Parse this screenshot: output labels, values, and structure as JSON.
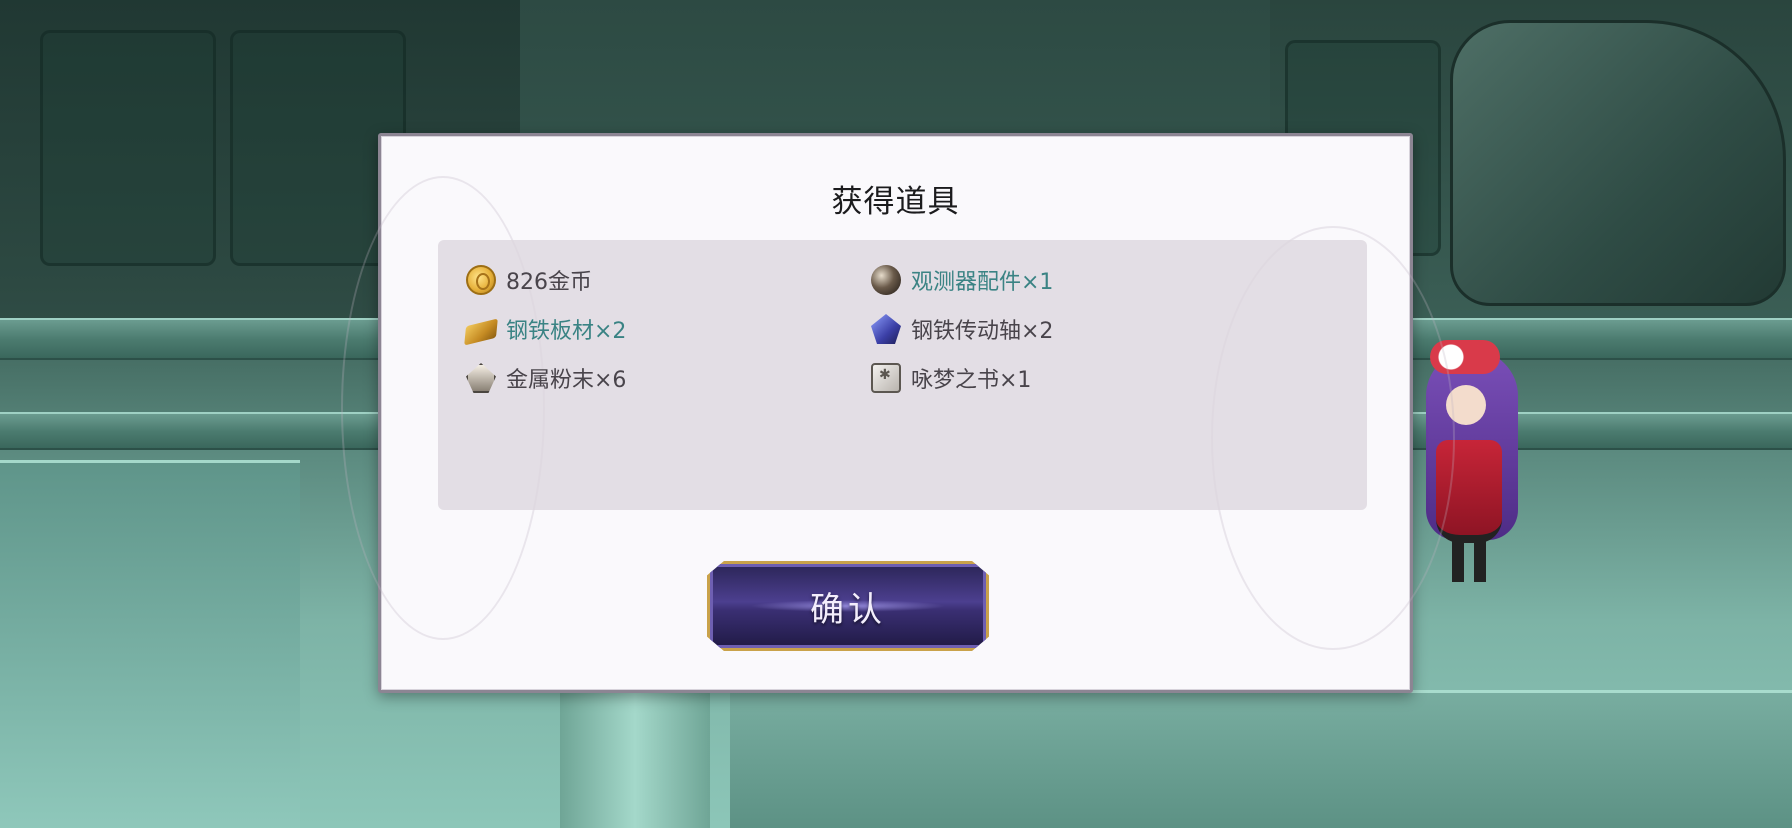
{
  "dialog": {
    "title": "获得道具",
    "items": [
      {
        "label": "826金币",
        "icon": "coin-icon",
        "rare": false
      },
      {
        "label": "观测器配件×1",
        "icon": "pearl-icon",
        "rare": true
      },
      {
        "label": "钢铁板材×2",
        "icon": "steel-plate-icon",
        "rare": true
      },
      {
        "label": "钢铁传动轴×2",
        "icon": "crystal-icon",
        "rare": false
      },
      {
        "label": "金属粉末×6",
        "icon": "metal-powder-icon",
        "rare": false
      },
      {
        "label": "咏梦之书×1",
        "icon": "book-icon",
        "rare": false
      }
    ],
    "confirm_label": "确认"
  },
  "colors": {
    "rare_text": "#3a8384",
    "normal_text": "#49444b",
    "button_gold": "#c9a24a",
    "button_purple": "#4c3f8f"
  }
}
